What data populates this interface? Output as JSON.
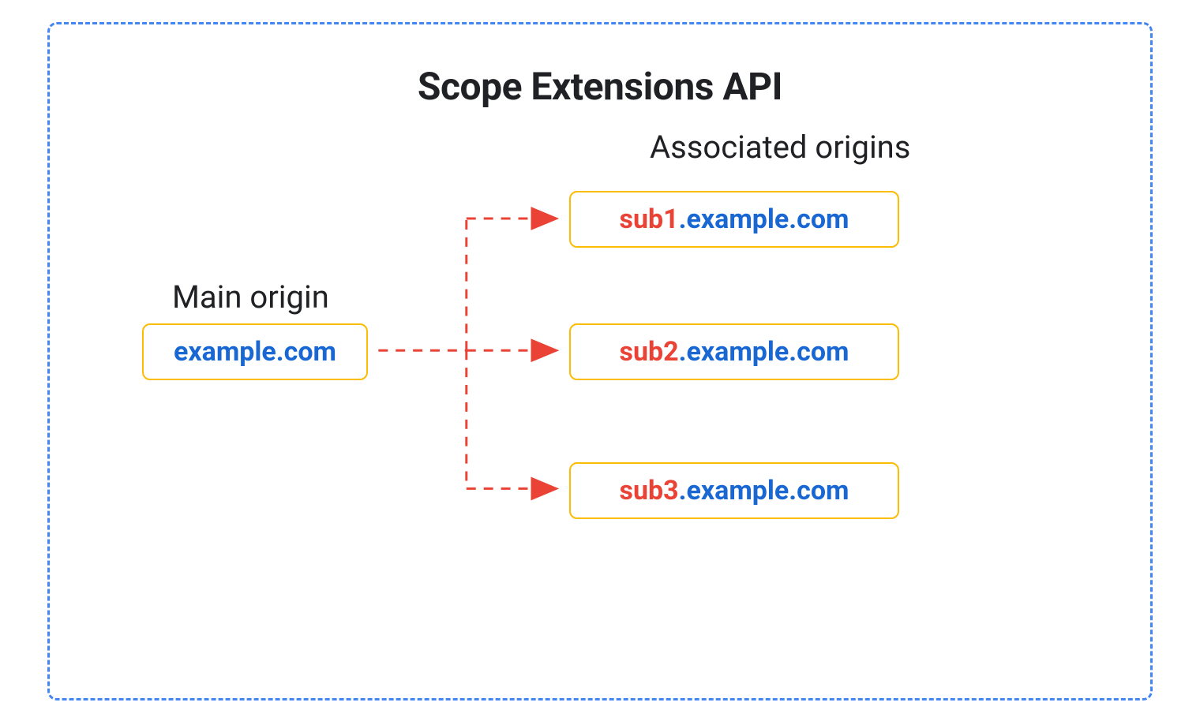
{
  "title": "Scope Extensions API",
  "main_origin": {
    "label": "Main origin",
    "domain": "example.com"
  },
  "associated_origins": {
    "label": "Associated origins",
    "items": [
      {
        "subdomain": "sub1",
        "domain": ".example.com"
      },
      {
        "subdomain": "sub2",
        "domain": ".example.com"
      },
      {
        "subdomain": "sub3",
        "domain": ".example.com"
      }
    ]
  },
  "colors": {
    "border_blue": "#4285f4",
    "box_border": "#fbbc04",
    "link_blue": "#1967d2",
    "accent_red": "#ea4335"
  }
}
